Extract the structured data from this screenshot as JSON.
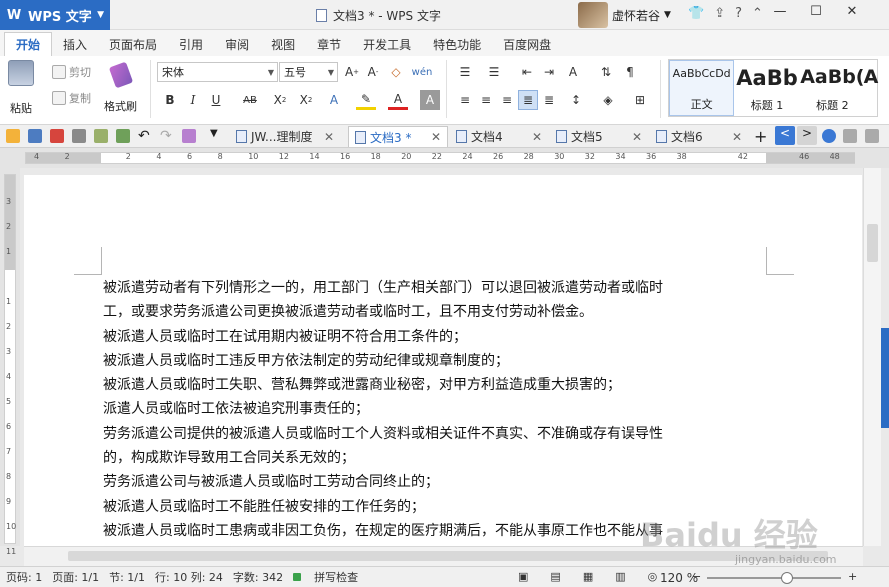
{
  "app": {
    "name": "WPS 文字",
    "doc_title": "文档3 * - WPS 文字",
    "user": "虚怀若谷"
  },
  "ribbon_tabs": [
    "开始",
    "插入",
    "页面布局",
    "引用",
    "审阅",
    "视图",
    "章节",
    "开发工具",
    "特色功能",
    "百度网盘"
  ],
  "clipboard": {
    "paste": "粘贴",
    "cut": "剪切",
    "copy": "复制",
    "format_painter": "格式刷"
  },
  "font": {
    "name": "宋体",
    "size": "五号"
  },
  "styles": [
    {
      "preview": "AaBbCcDd",
      "name": "正文"
    },
    {
      "preview": "AaBb",
      "name": "标题 1"
    },
    {
      "preview": "AaBb(",
      "name": "标题 2"
    },
    {
      "preview": "A",
      "name": ""
    }
  ],
  "doc_tabs": [
    {
      "label": "JW...理制度",
      "active": false
    },
    {
      "label": "文档3 *",
      "active": true
    },
    {
      "label": "文档4",
      "active": false
    },
    {
      "label": "文档5",
      "active": false
    },
    {
      "label": "文档6",
      "active": false
    }
  ],
  "ruler_numbers": [
    "4",
    "2",
    "",
    "2",
    "4",
    "6",
    "8",
    "10",
    "12",
    "14",
    "16",
    "18",
    "20",
    "22",
    "24",
    "26",
    "28",
    "30",
    "32",
    "34",
    "36",
    "38",
    "",
    "42",
    "",
    "46",
    "48"
  ],
  "vruler_numbers": [
    "3",
    "2",
    "1",
    "",
    "1",
    "2",
    "3",
    "4",
    "5",
    "6",
    "7",
    "8",
    "9",
    "10",
    "11",
    "12"
  ],
  "document_lines": [
    "被派遣劳动者有下列情形之一的，用工部门（生产相关部门）可以退回被派遣劳动者或临时",
    "工，或要求劳务派遣公司更换被派遣劳动者或临时工，且不用支付劳动补偿金。",
    "被派遣人员或临时工在试用期内被证明不符合用工条件的；",
    "被派遣人员或临时工违反甲方依法制定的劳动纪律或规章制度的；",
    "被派遣人员或临时工失职、营私舞弊或泄露商业秘密，对甲方利益造成重大损害的；",
    "派遣人员或临时工依法被追究刑事责任的；",
    "劳务派遣公司提供的被派遣人员或临时工个人资料或相关证件不真实、不准确或存有误导性",
    "的，构成欺诈导致用工合同关系无效的；",
    "劳务派遣公司与被派遣人员或临时工劳动合同终止的；",
    "被派遣人员或临时工不能胜任被安排的工作任务的；",
    "被派遣人员或临时工患病或非因工负伤，在规定的医疗期满后，不能从事原工作也不能从事"
  ],
  "status": {
    "page_num": "页码: 1",
    "pages": "页面: 1/1",
    "section": "节: 1/1",
    "row_col": "行: 10  列: 24",
    "words": "字数: 342",
    "spell": "拼写检查",
    "zoom": "120 %",
    "zoom_level": 0.6
  },
  "watermark": {
    "brand": "Baidu 经验",
    "url": "jingyan.baidu.com"
  }
}
